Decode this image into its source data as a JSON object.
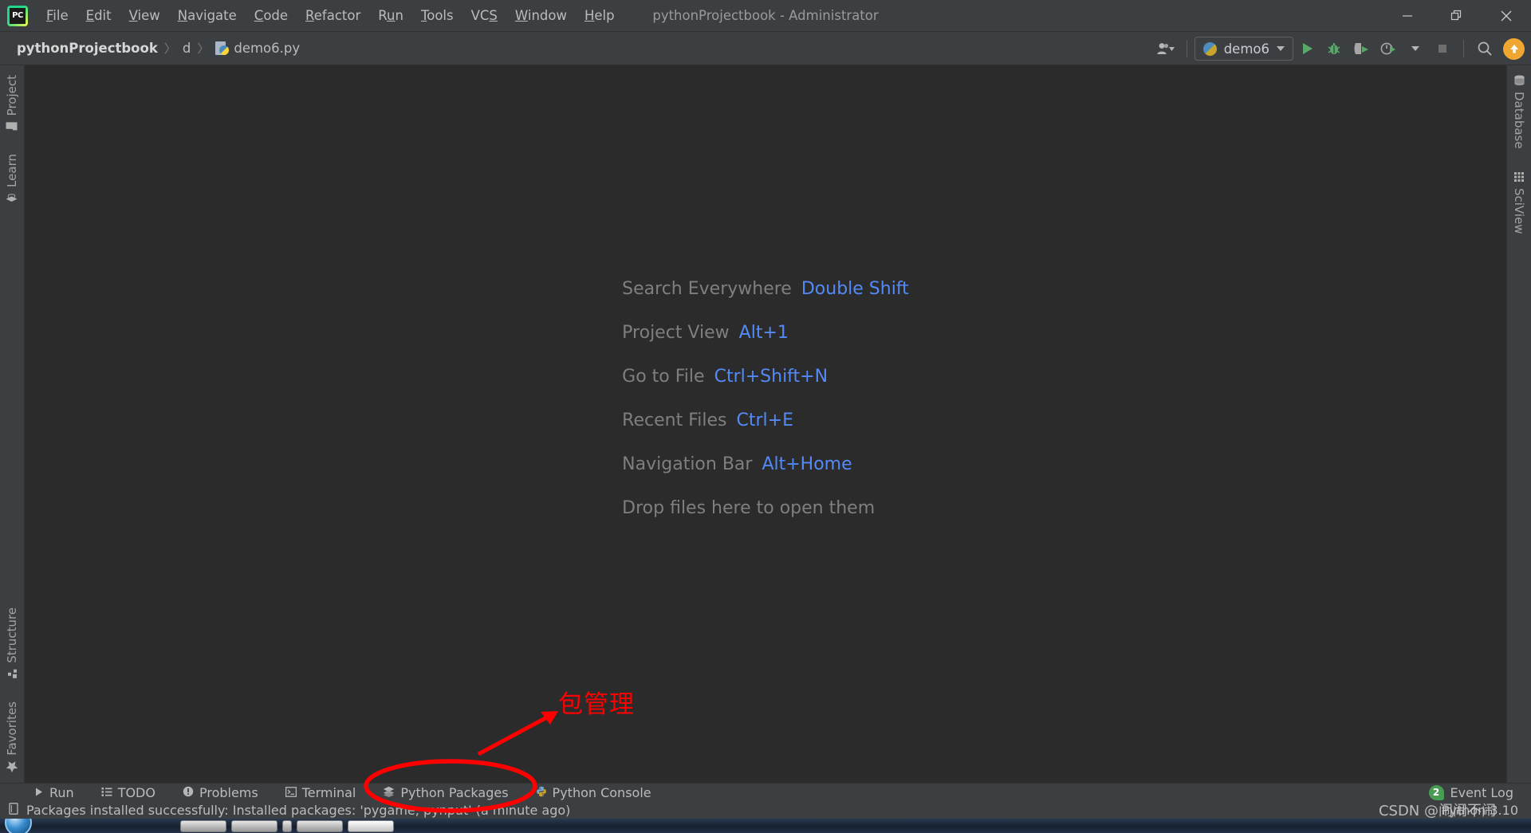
{
  "window": {
    "title": "pythonProjectbook - Administrator",
    "controls": {
      "minimize": "minimize-button",
      "restore": "restore-button",
      "close": "close-button"
    }
  },
  "menubar": {
    "items": [
      {
        "label": "File",
        "mnemonic": "F"
      },
      {
        "label": "Edit",
        "mnemonic": "E"
      },
      {
        "label": "View",
        "mnemonic": "V"
      },
      {
        "label": "Navigate",
        "mnemonic": "N"
      },
      {
        "label": "Code",
        "mnemonic": "C"
      },
      {
        "label": "Refactor",
        "mnemonic": "R"
      },
      {
        "label": "Run",
        "mnemonic": "u"
      },
      {
        "label": "Tools",
        "mnemonic": "T"
      },
      {
        "label": "VCS",
        "mnemonic": "S"
      },
      {
        "label": "Window",
        "mnemonic": "W"
      },
      {
        "label": "Help",
        "mnemonic": "H"
      }
    ]
  },
  "navbar": {
    "breadcrumbs": [
      {
        "label": "pythonProjectbook",
        "icon": ""
      },
      {
        "label": "d",
        "icon": ""
      },
      {
        "label": "demo6.py",
        "icon": "python-file-icon"
      }
    ],
    "separator": "〉",
    "run_config": {
      "label": "demo6",
      "icon": "python-icon"
    },
    "actions": [
      {
        "name": "user-account-icon",
        "label": ""
      },
      {
        "name": "run-button",
        "label": ""
      },
      {
        "name": "debug-button",
        "label": ""
      },
      {
        "name": "run-with-coverage-button",
        "label": ""
      },
      {
        "name": "profile-button",
        "label": ""
      },
      {
        "name": "stop-button",
        "label": ""
      },
      {
        "name": "search-icon",
        "label": ""
      },
      {
        "name": "update-available-icon",
        "label": ""
      }
    ]
  },
  "sidebar_left": {
    "top": [
      {
        "label": "Project",
        "icon": "folder-icon"
      },
      {
        "label": "Learn",
        "icon": "graduation-cap-icon"
      }
    ],
    "bottom": [
      {
        "label": "Structure",
        "icon": "structure-icon"
      },
      {
        "label": "Favorites",
        "icon": "star-icon"
      }
    ]
  },
  "sidebar_right": {
    "top": [
      {
        "label": "Database",
        "icon": "database-icon"
      },
      {
        "label": "SciView",
        "icon": "grid-icon"
      }
    ]
  },
  "editor": {
    "hints": [
      {
        "label": "Search Everywhere",
        "key": "Double Shift"
      },
      {
        "label": "Project View",
        "key": "Alt+1"
      },
      {
        "label": "Go to File",
        "key": "Ctrl+Shift+N"
      },
      {
        "label": "Recent Files",
        "key": "Ctrl+E"
      },
      {
        "label": "Navigation Bar",
        "key": "Alt+Home"
      }
    ],
    "drop_hint": "Drop files here to open them"
  },
  "bottom_bar": {
    "items": [
      {
        "label": "Run",
        "icon": "play-icon"
      },
      {
        "label": "TODO",
        "icon": "list-icon"
      },
      {
        "label": "Problems",
        "icon": "warning-icon"
      },
      {
        "label": "Terminal",
        "icon": "terminal-icon"
      },
      {
        "label": "Python Packages",
        "icon": "layers-icon"
      },
      {
        "label": "Python Console",
        "icon": "python-icon"
      }
    ],
    "event_log": {
      "label": "Event Log",
      "count": "2"
    }
  },
  "status_bar": {
    "message": "Packages installed successfully: Installed packages: 'pygame, pynput' (a minute ago)",
    "interpreter": "Python 3.10",
    "icon": "note-icon"
  },
  "watermark": {
    "text": "CSDN @闹闹不闹"
  },
  "annotation": {
    "text": "包管理",
    "color": "#ff0000",
    "target": "Python Packages"
  }
}
